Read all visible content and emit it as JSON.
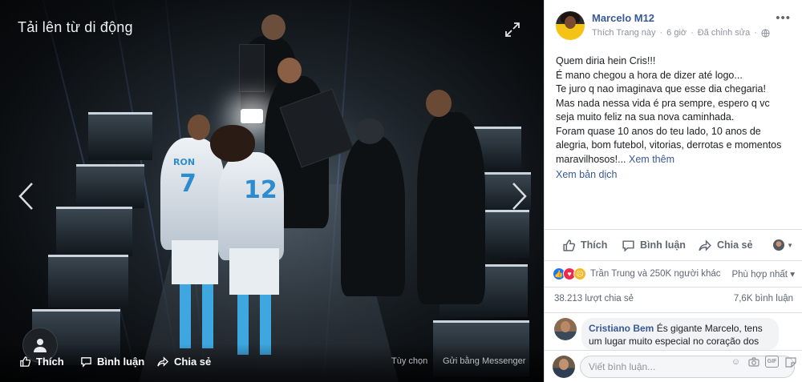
{
  "viewer": {
    "title": "Tải lên từ di động",
    "actions": {
      "like": "Thích",
      "comment": "Bình luận",
      "share": "Chia sẻ"
    },
    "links": {
      "options": "Tùy chọn",
      "send": "Gửi bằng Messenger"
    },
    "jersey_numbers": {
      "left": "7",
      "right": "12"
    },
    "jersey_name": "RON"
  },
  "post": {
    "author": "Marcelo M12",
    "meta": {
      "liked_page": "Thích Trang này",
      "time": "6 giờ",
      "edited": "Đã chỉnh sửa"
    },
    "text_lines": [
      "Quem diria hein Cris!!!",
      "É mano chegou a hora de dizer até logo...",
      "Te juro q nao imaginava que esse dia chegaria!",
      "Mas nada nessa vida é pra sempre, espero q vc",
      "seja muito feliz na sua nova caminhada.",
      "Foram quase 10 anos do teu lado, 10 anos de",
      "alegria, bom futebol, vitorias, derrotas e momentos"
    ],
    "last_line": "maravilhosos!...",
    "see_more": "Xem thêm",
    "translate": "Xem bản dịch"
  },
  "actions": {
    "like": "Thích",
    "comment": "Bình luận",
    "share": "Chia sẻ"
  },
  "reactions": {
    "summary": "Trần Trung và 250K người khác",
    "sort": "Phù hợp nhất"
  },
  "counts": {
    "shares": "38.213 lượt chia sẻ",
    "comments": "7,6K bình luận"
  },
  "comment": {
    "name": "Cristiano Bem",
    "text": "És gigante Marcelo, tens um lugar muito especial no coração dos"
  },
  "composer": {
    "placeholder": "Viết bình luận..."
  },
  "colors": {
    "link": "#385898",
    "panel_bg": "#ffffff",
    "viewer_bg": "#0a0d10"
  }
}
